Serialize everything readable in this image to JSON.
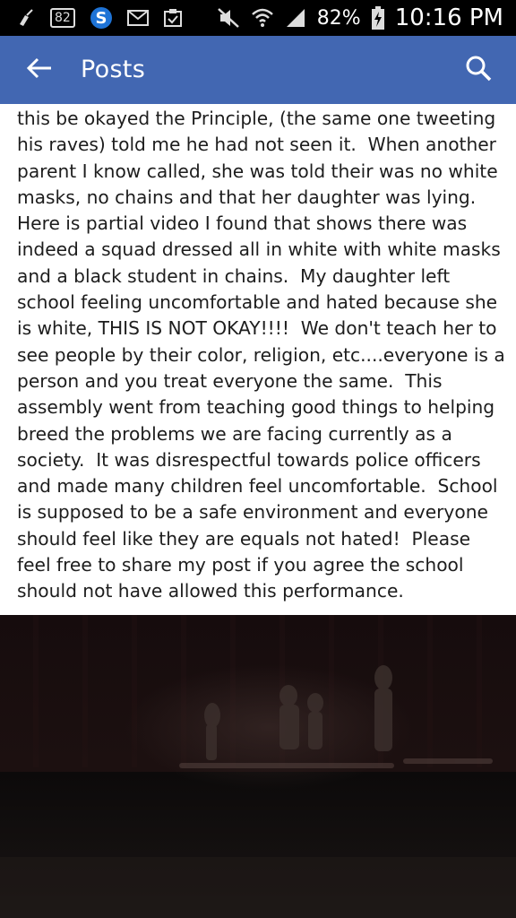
{
  "status_bar": {
    "notification_badge": "82",
    "battery_percent": "82%",
    "time": "10:16 PM",
    "icons": [
      "broom-icon",
      "sms-badge-icon",
      "s-app-icon",
      "mail-icon",
      "clipboard-check-icon",
      "mute-icon",
      "wifi-icon",
      "signal-icon",
      "battery-charging-icon"
    ]
  },
  "app_bar": {
    "title": "Posts",
    "color": "#4267b2",
    "back_icon": "arrow-left-icon",
    "search_icon": "search-icon"
  },
  "post": {
    "text": "this be okayed the Principle, (the same one tweeting\nhis raves) told me he had not seen it.  When another\nparent I know called, she was told their was no white\nmasks, no chains and that her daughter was lying.\nHere is partial video I found that shows there was\nindeed a squad dressed all in white with white masks\nand a black student in chains.  My daughter left\nschool feeling uncomfortable and hated because she\nis white, THIS IS NOT OKAY!!!!  We don't teach her to\nsee people by their color, religion, etc....everyone is a\nperson and you treat everyone the same.  This\nassembly went from teaching good things to helping\nbreed the problems we are facing currently as a\nsociety.  It was disrespectful towards police officers\nand made many children feel uncomfortable.  School\nis supposed to be a safe environment and everyone\nshould feel like they are equals not hated!  Please\nfeel free to share my post if you agree the school\nshould not have allowed this performance."
  },
  "video": {
    "background_color": "#0b0708"
  }
}
